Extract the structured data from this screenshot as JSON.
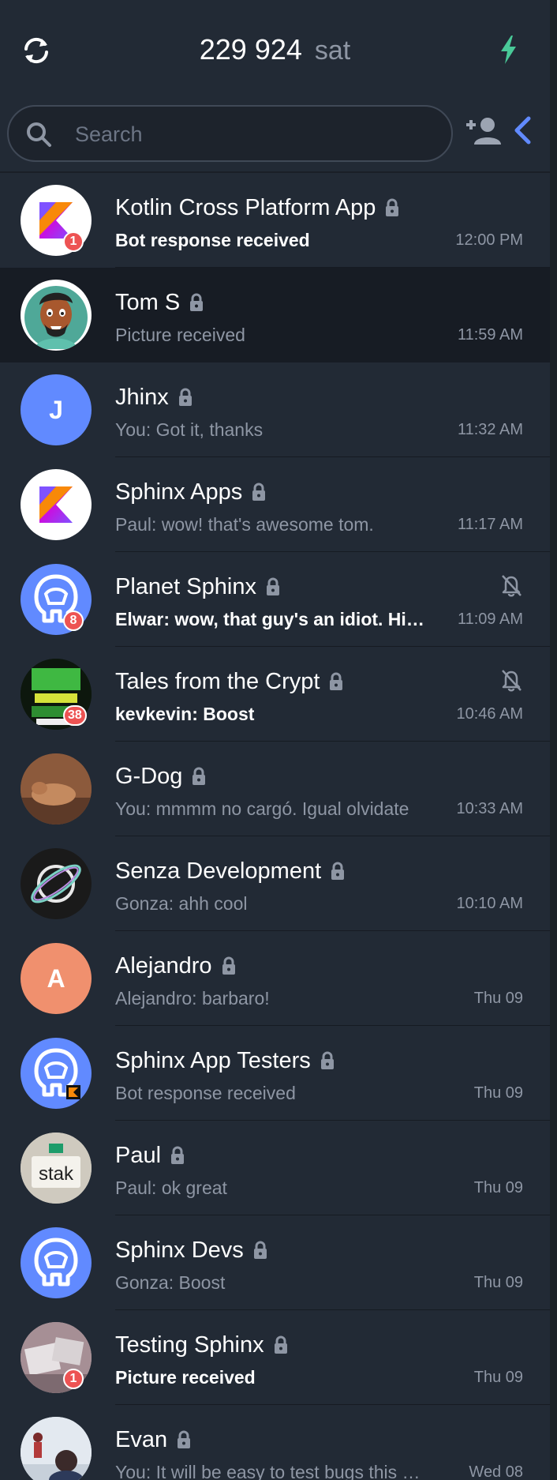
{
  "header": {
    "balance_amount": "229 924",
    "balance_unit": "sat"
  },
  "search": {
    "placeholder": "Search"
  },
  "colors": {
    "accent": "#618aff",
    "bolt": "#49c998",
    "badge": "#ed5353",
    "background": "#222a35",
    "selected_row": "#171c24"
  },
  "chats": [
    {
      "name": "Kotlin Cross Platform App",
      "preview": "Bot response received",
      "time": "12:00 PM",
      "unread": true,
      "badge": "1",
      "avatar": "kotlin-logo"
    },
    {
      "name": "Tom S",
      "preview": "Picture received",
      "time": "11:59 AM",
      "unread": false,
      "avatar": "cartoon-face"
    },
    {
      "name": "Jhinx",
      "preview": "You: Got it, thanks",
      "time": "11:32 AM",
      "unread": false,
      "initial": "J",
      "avatar_color": "#618aff"
    },
    {
      "name": "Sphinx Apps",
      "preview": "Paul: wow! that's awesome tom.",
      "time": "11:17 AM",
      "unread": false,
      "avatar": "kotlin-logo"
    },
    {
      "name": "Planet Sphinx",
      "preview": "Elwar: wow, that guy's an idiot. Him…",
      "time": "11:09 AM",
      "unread": true,
      "badge": "8",
      "muted": true,
      "avatar": "sphinx-logo"
    },
    {
      "name": "Tales from the Crypt",
      "preview": "kevkevin: Boost",
      "time": "10:46 AM",
      "unread": true,
      "badge": "38",
      "muted": true,
      "avatar": "tales-from-the-crypt"
    },
    {
      "name": "G-Dog",
      "preview": "You: mmmm no cargó. Igual olvidate",
      "time": "10:33 AM",
      "unread": false,
      "avatar": "dog-photo"
    },
    {
      "name": "Senza Development",
      "preview": "Gonza: ahh cool",
      "time": "10:10 AM",
      "unread": false,
      "avatar": "planet-ring-logo"
    },
    {
      "name": "Alejandro",
      "preview": "Alejandro: barbaro!",
      "time": "Thu 09",
      "unread": false,
      "initial": "A",
      "avatar_color": "#f0906e"
    },
    {
      "name": "Sphinx App Testers",
      "preview": "Bot response received",
      "time": "Thu 09",
      "unread": false,
      "avatar": "sphinx-logo"
    },
    {
      "name": "Paul",
      "preview": "Paul: ok great",
      "time": "Thu 09",
      "unread": false,
      "avatar": "stak-photo"
    },
    {
      "name": "Sphinx Devs",
      "preview": "Gonza: Boost",
      "time": "Thu 09",
      "unread": false,
      "avatar": "sphinx-logo"
    },
    {
      "name": "Testing Sphinx",
      "preview": "Picture received",
      "time": "Thu 09",
      "unread": true,
      "badge": "1",
      "avatar": "photo"
    },
    {
      "name": "Evan",
      "preview": "You: It will be easy to test bugs this w…",
      "time": "Wed 08",
      "unread": false,
      "avatar": "snow-photo"
    }
  ]
}
